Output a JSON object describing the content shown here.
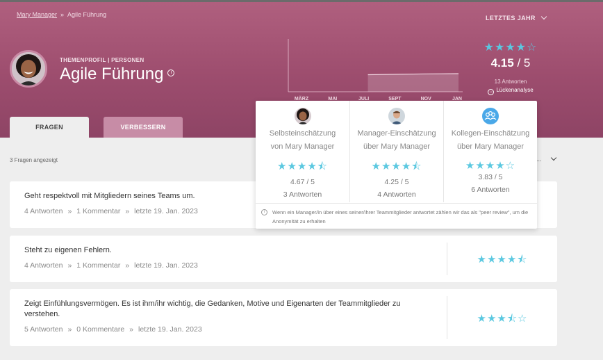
{
  "breadcrumb": {
    "parent": "Mary Manager",
    "separator": "»",
    "current": "Agile Führung"
  },
  "period": {
    "label": "LETZTES JAHR"
  },
  "profile": {
    "kicker": "THEMENPROFIL | PERSONEN",
    "title": "Agile Führung",
    "info_glyph": "i"
  },
  "chart_data": {
    "type": "area",
    "categories": [
      "MÄRZ",
      "MAI",
      "JULI",
      "SEPT",
      "NOV",
      "JAN"
    ],
    "x_start": "JULI",
    "values": [
      3.9,
      4.0,
      4.1,
      4.15
    ],
    "ylim": [
      0,
      5
    ],
    "grid": false,
    "title": "",
    "xlabel": "",
    "ylabel": ""
  },
  "score": {
    "stars": "★★★★☆",
    "value": "4.15",
    "slash": " / ",
    "max": "5",
    "answers": "13 Antworten",
    "gap_label": "Lückenanalyse",
    "gap_glyph": "↔"
  },
  "tabs": [
    {
      "label": "FRAGEN",
      "active": true
    },
    {
      "label": "VERBESSERN",
      "active": false
    }
  ],
  "list": {
    "shown": "3 Fragen angezeigt",
    "sort_ellipsis": "..."
  },
  "questions": [
    {
      "text": "Geht respektvoll mit Mitgliedern seines Teams um.",
      "answers": "4 Antworten",
      "comments": "1 Kommentar",
      "date": "letzte 19. Jan. 2023",
      "stars": ""
    },
    {
      "text": "Steht zu eigenen Fehlern.",
      "answers": "4 Antworten",
      "comments": "1 Kommentar",
      "date": "letzte 19. Jan. 2023",
      "stars": "★★★★⯪"
    },
    {
      "text": "Zeigt Einfühlungsvermögen. Es ist ihm/ihr wichtig, die Gedanken, Motive und Eigenarten der Teammitglieder zu verstehen.",
      "answers": "5 Antworten",
      "comments": "0 Kommentare",
      "date": "letzte 19. Jan. 2023",
      "stars": "★★★⯪☆"
    }
  ],
  "meta_sep": "»",
  "popup": {
    "columns": [
      {
        "title1": "Selbsteinschätzung",
        "title2": "von Mary Manager",
        "stars": "★★★★⯪",
        "value": "4.67 / 5",
        "answers": "3 Antworten"
      },
      {
        "title1": "Manager-Einschätzung",
        "title2": "über Mary Manager",
        "stars": "★★★★⯪",
        "value": "4.25 / 5",
        "answers": "4 Antworten"
      },
      {
        "title1": "Kollegen-Einschätzung",
        "title2": "über Mary Manager",
        "stars": "★★★★☆",
        "value": "3.83 / 5",
        "answers": "6 Antworten"
      }
    ],
    "note": "Wenn ein Manager/in über eines seiner/ihrer Teammitglieder antwortet zählen wir das als \"peer review\", um die Anonymität zu erhalten",
    "note_glyph": "i"
  },
  "colors": {
    "accent": "#5bc8e0",
    "hero": "#9d4d6e",
    "tab_inactive": "#c78ca6"
  }
}
